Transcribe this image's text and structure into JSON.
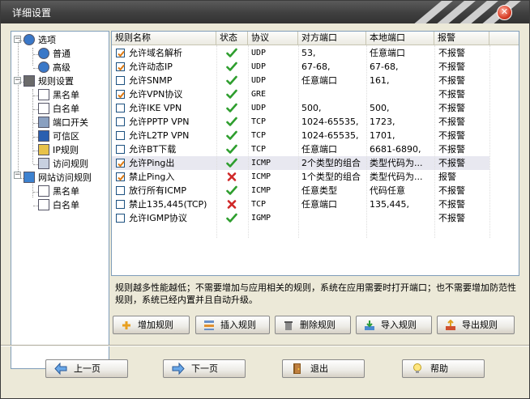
{
  "window": {
    "title": "详细设置",
    "close_glyph": "✕"
  },
  "tree": [
    {
      "label": "选项",
      "icon": "gear-icon"
    },
    {
      "label": "普通",
      "icon": "gear-icon"
    },
    {
      "label": "高级",
      "icon": "gear-icon"
    },
    {
      "label": "规则设置",
      "icon": "rules-icon"
    },
    {
      "label": "黑名单",
      "icon": "document-icon"
    },
    {
      "label": "白名单",
      "icon": "document-icon"
    },
    {
      "label": "端口开关",
      "icon": "port-icon"
    },
    {
      "label": "可信区",
      "icon": "trusted-zone-icon"
    },
    {
      "label": "IP规则",
      "icon": "ip-rule-icon"
    },
    {
      "label": "访问规则",
      "icon": "exe-icon"
    },
    {
      "label": "网站访问规则",
      "icon": "ie-icon"
    },
    {
      "label": "黑名单",
      "icon": "document-icon"
    },
    {
      "label": "白名单",
      "icon": "document-icon"
    }
  ],
  "table": {
    "columns": [
      "规则名称",
      "状态",
      "协议",
      "对方端口",
      "本地端口",
      "报警"
    ],
    "rows": [
      {
        "checked": true,
        "name": "允许域名解析",
        "status": "allow",
        "protocol": "UDP",
        "remote": "53,",
        "local": "任意端口",
        "alarm": "不报警"
      },
      {
        "checked": true,
        "name": "允许动态IP",
        "status": "allow",
        "protocol": "UDP",
        "remote": "67-68,",
        "local": "67-68,",
        "alarm": "不报警"
      },
      {
        "checked": false,
        "name": "允许SNMP",
        "status": "allow",
        "protocol": "UDP",
        "remote": "任意端口",
        "local": "161,",
        "alarm": "不报警"
      },
      {
        "checked": true,
        "name": "允许VPN协议",
        "status": "allow",
        "protocol": "GRE",
        "remote": "",
        "local": "",
        "alarm": "不报警"
      },
      {
        "checked": false,
        "name": "允许IKE VPN",
        "status": "allow",
        "protocol": "UDP",
        "remote": "500,",
        "local": "500,",
        "alarm": "不报警"
      },
      {
        "checked": false,
        "name": "允许PPTP VPN",
        "status": "allow",
        "protocol": "TCP",
        "remote": "1024-65535,",
        "local": "1723,",
        "alarm": "不报警"
      },
      {
        "checked": false,
        "name": "允许L2TP VPN",
        "status": "allow",
        "protocol": "TCP",
        "remote": "1024-65535,",
        "local": "1701,",
        "alarm": "不报警"
      },
      {
        "checked": false,
        "name": "允许BT下载",
        "status": "allow",
        "protocol": "TCP",
        "remote": "任意端口",
        "local": "6681-6890,",
        "alarm": "不报警"
      },
      {
        "checked": true,
        "name": "允许Ping出",
        "status": "allow",
        "protocol": "ICMP",
        "remote": "2个类型的组合",
        "local": "类型代码为...",
        "alarm": "不报警"
      },
      {
        "checked": true,
        "name": "禁止Ping入",
        "status": "deny",
        "protocol": "ICMP",
        "remote": "1个类型的组合",
        "local": "类型代码为...",
        "alarm": "报警"
      },
      {
        "checked": false,
        "name": "放行所有ICMP",
        "status": "allow",
        "protocol": "ICMP",
        "remote": "任意类型",
        "local": "代码任意",
        "alarm": "不报警"
      },
      {
        "checked": false,
        "name": "禁止135,445(TCP)",
        "status": "deny",
        "protocol": "TCP",
        "remote": "任意端口",
        "local": "135,445,",
        "alarm": "不报警"
      },
      {
        "checked": false,
        "name": "允许IGMP协议",
        "status": "allow",
        "protocol": "IGMP",
        "remote": "",
        "local": "",
        "alarm": "不报警"
      }
    ]
  },
  "description": "规则越多性能越低；不需要增加与应用相关的规则，系统在应用需要时打开端口；也不需要增加防范性规则，系统已经内置并且自动升级。",
  "actions": [
    {
      "label": "增加规则",
      "icon": "plus-icon"
    },
    {
      "label": "插入规则",
      "icon": "insert-icon"
    },
    {
      "label": "删除规则",
      "icon": "delete-icon"
    },
    {
      "label": "导入规则",
      "icon": "import-icon"
    },
    {
      "label": "导出规则",
      "icon": "export-icon"
    }
  ],
  "nav": [
    {
      "label": "上一页",
      "icon": "arrow-left-icon"
    },
    {
      "label": "下一页",
      "icon": "arrow-right-icon"
    },
    {
      "label": "退出",
      "icon": "exit-door-icon"
    },
    {
      "label": "帮助",
      "icon": "help-bulb-icon"
    }
  ],
  "colors": {
    "allow": "#2e9e2e",
    "deny": "#d02828",
    "checkmark": "#e07a10",
    "selected_row": "#e8e8f0"
  }
}
